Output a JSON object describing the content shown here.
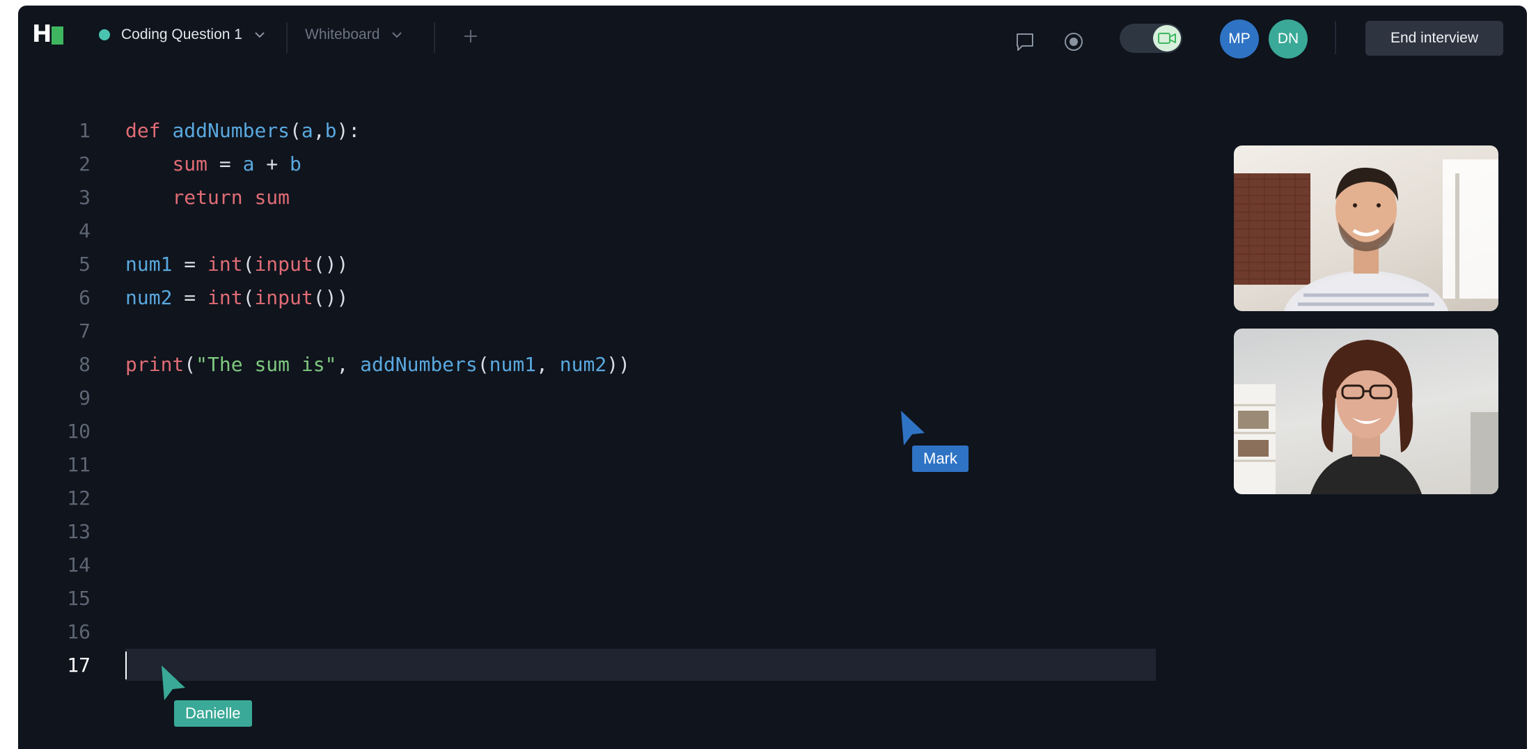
{
  "app": {
    "logo": "H"
  },
  "tabs": [
    {
      "label": "Coding Question 1",
      "active": true,
      "status_color": "#4ac4b0"
    },
    {
      "label": "Whiteboard",
      "active": false
    }
  ],
  "header": {
    "participants": [
      {
        "initials": "MP",
        "color": "#2f73c4"
      },
      {
        "initials": "DN",
        "color": "#3aa997"
      }
    ],
    "end_button": "End interview",
    "icons": [
      "chat-icon",
      "record-icon",
      "video-camera-icon",
      "plus-icon"
    ]
  },
  "editor": {
    "language": "python",
    "active_line": 17,
    "line_numbers": [
      "1",
      "2",
      "3",
      "4",
      "5",
      "6",
      "7",
      "8",
      "9",
      "10",
      "11",
      "12",
      "13",
      "14",
      "15",
      "16",
      "17"
    ],
    "lines": {
      "l1": {
        "kw": "def",
        "fn": "addNumbers",
        "a": "a",
        "b": "b"
      },
      "l2": {
        "kw": "sum",
        "a": "a",
        "b": "b"
      },
      "l3": {
        "kw": "return",
        "kw2": "sum"
      },
      "l5": {
        "var": "num1",
        "bi1": "int",
        "bi2": "input"
      },
      "l6": {
        "var": "num2",
        "bi1": "int",
        "bi2": "input"
      },
      "l8": {
        "bi": "print",
        "str": "\"The sum is\"",
        "fn": "addNumbers",
        "v1": "num1",
        "v2": "num2"
      }
    }
  },
  "cursors": [
    {
      "name": "Mark",
      "color": "#2f73c4"
    },
    {
      "name": "Danielle",
      "color": "#3aa997"
    }
  ]
}
